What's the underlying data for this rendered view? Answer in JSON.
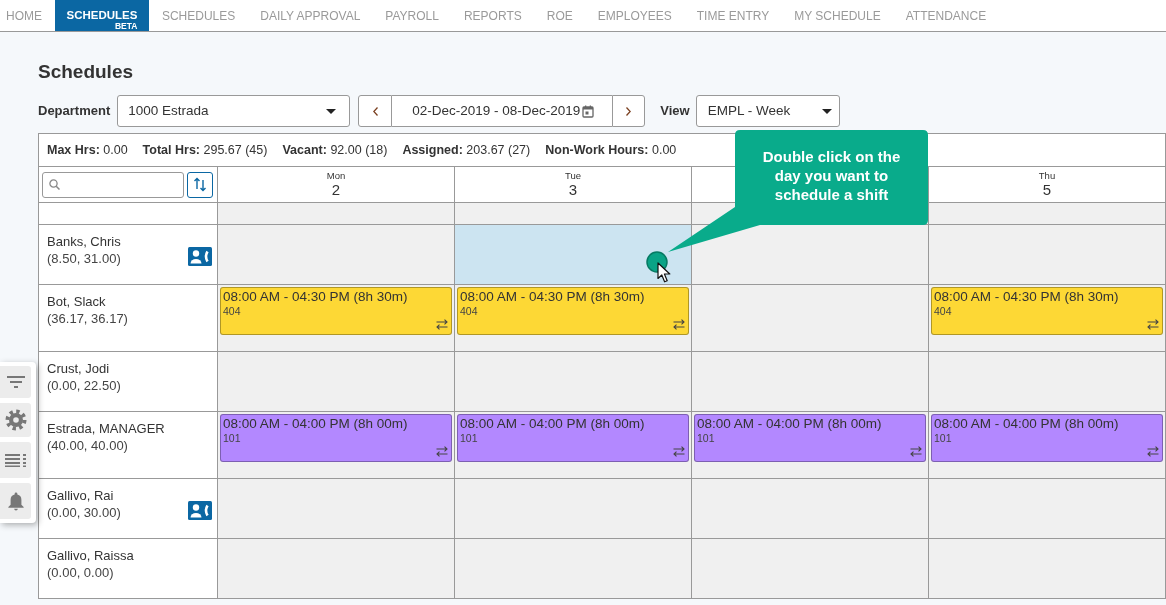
{
  "nav_tabs": [
    {
      "label": "HOME",
      "selected": false
    },
    {
      "label": "SCHEDULES",
      "badge": "BETA",
      "selected": true
    },
    {
      "label": "SCHEDULES",
      "selected": false
    },
    {
      "label": "DAILY APPROVAL",
      "selected": false
    },
    {
      "label": "PAYROLL",
      "selected": false
    },
    {
      "label": "REPORTS",
      "selected": false
    },
    {
      "label": "ROE",
      "selected": false
    },
    {
      "label": "EMPLOYEES",
      "selected": false
    },
    {
      "label": "TIME ENTRY",
      "selected": false
    },
    {
      "label": "MY SCHEDULE",
      "selected": false
    },
    {
      "label": "ATTENDANCE",
      "selected": false
    }
  ],
  "page_title": "Schedules",
  "toolbar": {
    "department": {
      "label": "Department",
      "value": "1000 Estrada"
    },
    "date_range": "02-Dec-2019 - 08-Dec-2019",
    "view": {
      "label": "View",
      "value": "EMPL - Week"
    }
  },
  "stats": [
    {
      "label": "Max Hrs:",
      "value": "0.00"
    },
    {
      "label": "Total Hrs:",
      "value": "295.67 (45)"
    },
    {
      "label": "Vacant:",
      "value": "92.00 (18)"
    },
    {
      "label": "Assigned:",
      "value": "203.67 (27)"
    },
    {
      "label": "Non-Work Hours:",
      "value": "0.00"
    }
  ],
  "days": [
    {
      "weekday": "Mon",
      "date": "2"
    },
    {
      "weekday": "Tue",
      "date": "3"
    },
    {
      "callout": "Double click on the day you want to schedule a shift"
    },
    {
      "weekday": "Thu",
      "date": "5"
    }
  ],
  "employees": [
    {
      "name": "Banks, Chris",
      "hours": "(8.50, 31.00)",
      "contact_badge": true,
      "days": [
        {
          "selected": false
        },
        {
          "selected": true
        },
        {
          "selected": false
        },
        {
          "selected": false
        }
      ]
    },
    {
      "name": "Bot, Slack",
      "hours": "(36.17, 36.17)",
      "contact_badge": false,
      "days": [
        {
          "selected": false,
          "shift": {
            "time": "08:00 AM - 04:30 PM (8h 30m)",
            "code": "404",
            "color": "#fdd835"
          }
        },
        {
          "selected": false,
          "shift": {
            "time": "08:00 AM - 04:30 PM (8h 30m)",
            "code": "404",
            "color": "#fdd835"
          }
        },
        {
          "selected": false
        },
        {
          "selected": false,
          "shift": {
            "time": "08:00 AM - 04:30 PM (8h 30m)",
            "code": "404",
            "color": "#fdd835"
          }
        }
      ]
    },
    {
      "name": "Crust, Jodi",
      "hours": "(0.00, 22.50)",
      "contact_badge": false,
      "days": [
        {
          "selected": false
        },
        {
          "selected": false
        },
        {
          "selected": false
        },
        {
          "selected": false
        }
      ]
    },
    {
      "name": "Estrada, MANAGER",
      "hours": "(40.00, 40.00)",
      "contact_badge": false,
      "days": [
        {
          "selected": false,
          "shift": {
            "time": "08:00 AM - 04:00 PM (8h 00m)",
            "code": "101",
            "color": "#b388ff"
          }
        },
        {
          "selected": false,
          "shift": {
            "time": "08:00 AM - 04:00 PM (8h 00m)",
            "code": "101",
            "color": "#b388ff"
          }
        },
        {
          "selected": false,
          "shift": {
            "time": "08:00 AM - 04:00 PM (8h 00m)",
            "code": "101",
            "color": "#b388ff"
          }
        },
        {
          "selected": false,
          "shift": {
            "time": "08:00 AM - 04:00 PM (8h 00m)",
            "code": "101",
            "color": "#b388ff"
          }
        }
      ]
    },
    {
      "name": "Gallivo, Rai",
      "hours": "(0.00, 30.00)",
      "contact_badge": true,
      "days": [
        {
          "selected": false
        },
        {
          "selected": false
        },
        {
          "selected": false
        },
        {
          "selected": false
        }
      ]
    },
    {
      "name": "Gallivo, Raissa",
      "hours": "(0.00, 0.00)",
      "contact_badge": false,
      "days": [
        {
          "selected": false
        },
        {
          "selected": false
        },
        {
          "selected": false
        },
        {
          "selected": false
        }
      ]
    }
  ]
}
